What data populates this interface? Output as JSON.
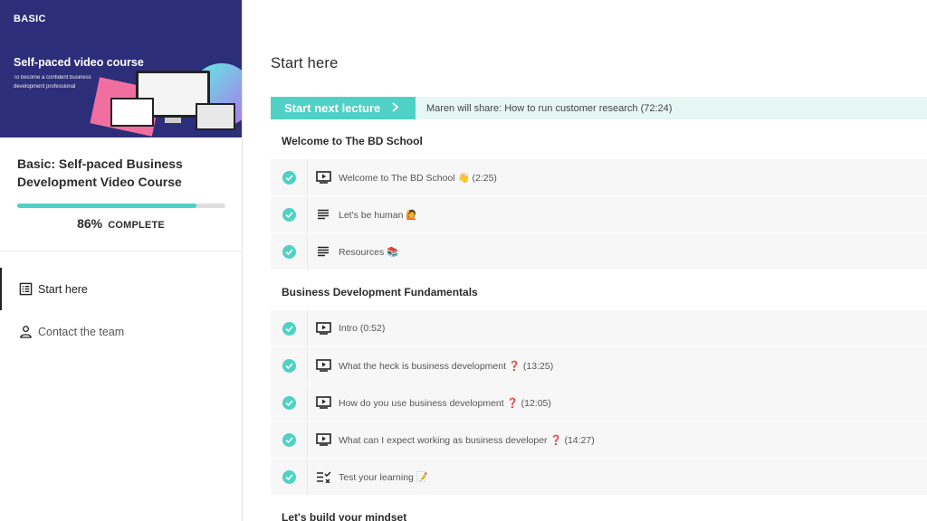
{
  "sidebar": {
    "hero": {
      "brand": "BASIC",
      "title": "Self-paced video course",
      "subtitle": "To become a confident business development professional"
    },
    "course_title": "Basic: Self-paced Business Development Video Course",
    "progress": {
      "percent": 86,
      "percent_label": "86%",
      "complete_label": "COMPLETE"
    },
    "nav": [
      {
        "label": "Start here",
        "icon": "list-icon",
        "active": true
      },
      {
        "label": "Contact the team",
        "icon": "person-icon",
        "active": false
      }
    ]
  },
  "main": {
    "title": "Start here",
    "next": {
      "button_label": "Start next lecture",
      "info": "Maren will share: How to run customer research (72:24)"
    },
    "sections": [
      {
        "title": "Welcome to The BD School",
        "lectures": [
          {
            "name": "Welcome to The BD School 👋 (2:25)",
            "type": "video"
          },
          {
            "name": "Let's be human 🙋",
            "type": "text"
          },
          {
            "name": "Resources 📚",
            "type": "text"
          }
        ]
      },
      {
        "title": "Business Development Fundamentals",
        "lectures": [
          {
            "name": "Intro (0:52)",
            "type": "video"
          },
          {
            "name": "What the heck is business development ❓ (13:25)",
            "type": "video"
          },
          {
            "name": "How do you use business development ❓ (12:05)",
            "type": "video"
          },
          {
            "name": "What can I expect working as business developer ❓ (14:27)",
            "type": "video"
          },
          {
            "name": "Test your learning 📝",
            "type": "quiz"
          }
        ]
      },
      {
        "title": "Let's build your mindset",
        "lectures": []
      }
    ]
  },
  "colors": {
    "accent": "#4fd1c5",
    "hero_bg": "#2d2e7a",
    "row_bg": "#f7f7f7"
  }
}
